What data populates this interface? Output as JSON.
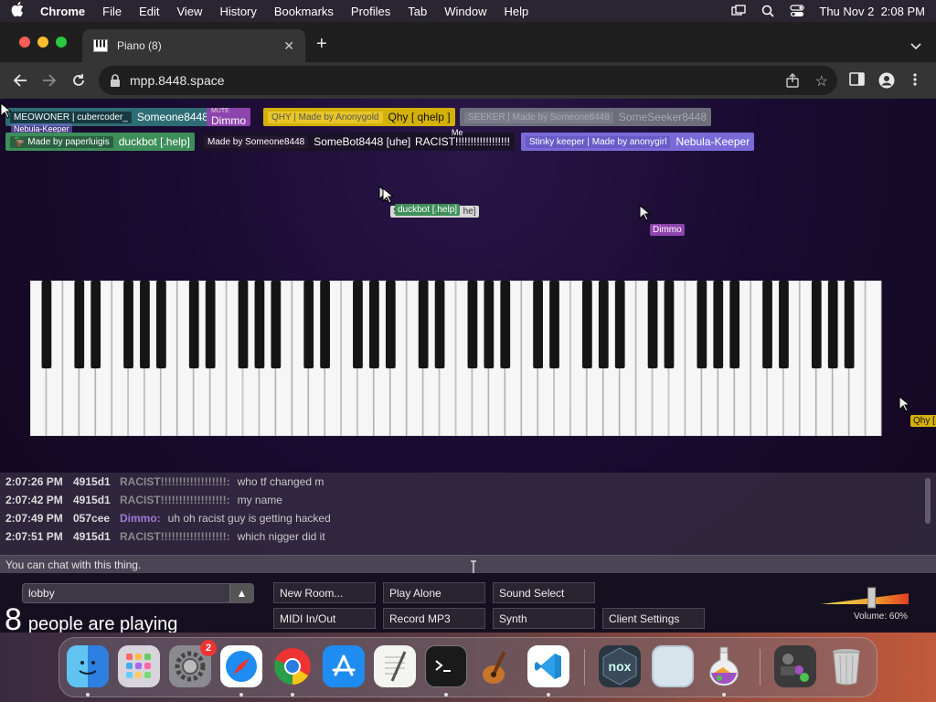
{
  "menubar": {
    "app_name": "Chrome",
    "items": [
      "File",
      "Edit",
      "View",
      "History",
      "Bookmarks",
      "Profiles",
      "Tab",
      "Window",
      "Help"
    ],
    "clock": "Thu Nov 2  2:08 PM"
  },
  "browser": {
    "tab_title": "Piano (8)",
    "url": "mpp.8448.space"
  },
  "nametags": {
    "row1": [
      {
        "tag": "MEOWONER | cubercoder_",
        "name": "Someone8448",
        "bg": "#2f6d74"
      },
      {
        "tag": "MUTE",
        "name": "Dimmo",
        "bg": "#8e44ad"
      },
      {
        "tag": "QHY | Made by Anonygold",
        "name": "Qhy [ qhelp ]",
        "bg": "#d4b10a"
      },
      {
        "tag": "SEEKER | Made by Someone8448",
        "name": "SomeSeeker8448",
        "bg": "#6d6d7c"
      }
    ],
    "row1_overlay": "Nebula-Keeper",
    "row2": [
      {
        "tag": "Made by paperluigis",
        "name": "duckbot [.help]",
        "bg": "#3e8e5a"
      },
      {
        "tag": "Made by Someone8448",
        "name": "SomeBot8448 [uhe]",
        "bg": "#1a1226"
      },
      {
        "name": "RACIST!!!!!!!!!!!!!!!!!!",
        "overlay": "Me",
        "bg": "#1a1226"
      },
      {
        "tag": "Stinky keeper | Made by anonygirl",
        "name": "Nebula-Keeper",
        "bg": "#7a6ad8"
      }
    ]
  },
  "cursors": {
    "duckbot_label": "duckbot [.help]",
    "duckbot_underlay": "S",
    "somebot_suffix": "he]",
    "dimmo_label": "Dimmo",
    "qhy_label": "Qhy ["
  },
  "chat": {
    "messages": [
      {
        "time": "2:07:26 PM",
        "id": "4915d1",
        "name": "RACIST!!!!!!!!!!!!!!!!!!:",
        "text": "who tf changed m",
        "color": "#8a8a8a"
      },
      {
        "time": "2:07:42 PM",
        "id": "4915d1",
        "name": "RACIST!!!!!!!!!!!!!!!!!!:",
        "text": "my name",
        "color": "#8a8a8a"
      },
      {
        "time": "2:07:49 PM",
        "id": "057cee",
        "name": "Dimmo:",
        "text": "uh oh racist guy is getting hacked",
        "color": "#a07ad8"
      },
      {
        "time": "2:07:51 PM",
        "id": "4915d1",
        "name": "RACIST!!!!!!!!!!!!!!!!!!:",
        "text": "which nigger did it",
        "color": "#8a8a8a"
      }
    ],
    "input_placeholder": "You can chat with this thing."
  },
  "controls": {
    "room": "lobby",
    "player_count": "8",
    "player_count_label": "people are playing",
    "buttons": {
      "new_room": "New Room...",
      "play_alone": "Play Alone",
      "sound_select": "Sound Select",
      "midi": "MIDI In/Out",
      "record_mp3": "Record MP3",
      "synth": "Synth",
      "client_settings": "Client Settings"
    },
    "volume_label": "Volume: 60%",
    "volume": 0.6
  },
  "dock": {
    "apps": [
      "finder-icon",
      "launchpad-icon",
      "system-settings-icon",
      "safari-icon",
      "chrome-icon",
      "app-store-icon",
      "textedit-icon",
      "terminal-icon",
      "garageband-icon",
      "vscode-icon",
      "nox-icon",
      "preview-icon",
      "potion-icon",
      "downloads-stack-icon",
      "trash-icon"
    ],
    "settings_badge": "2",
    "nox_text": "nox"
  }
}
